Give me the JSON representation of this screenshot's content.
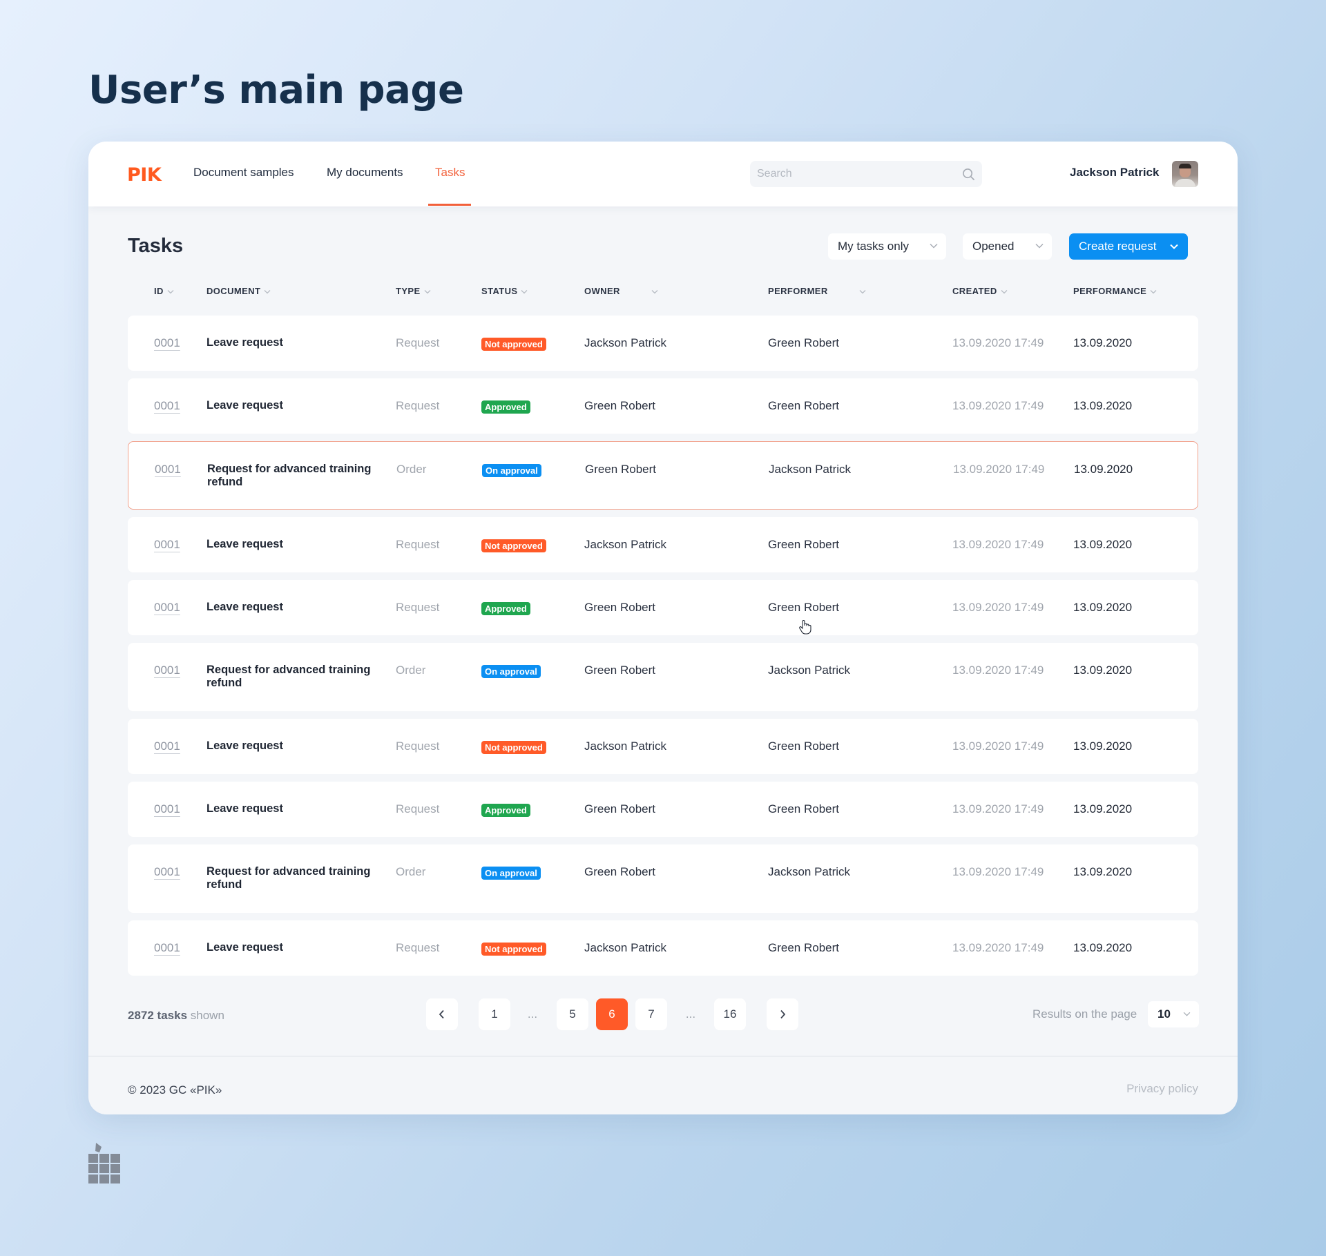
{
  "page": {
    "title": "User’s main page"
  },
  "header": {
    "logo": "PIK",
    "nav": [
      {
        "label": "Document samples",
        "active": false
      },
      {
        "label": "My documents",
        "active": false
      },
      {
        "label": "Tasks",
        "active": true
      }
    ],
    "search": {
      "placeholder": "Search",
      "value": ""
    },
    "user_name": "Jackson Patrick",
    "accent_color": "#f2603a"
  },
  "toolbar": {
    "title": "Tasks",
    "filter_scope": "My tasks only",
    "filter_state": "Opened",
    "create_label": "Create request",
    "create_color": "#0b8ff2"
  },
  "table": {
    "columns": [
      "ID",
      "DOCUMENT",
      "TYPE",
      "STATUS",
      "OWNER",
      "PERFORMER",
      "CREATED",
      "PERFORMANCE"
    ],
    "status_colors": {
      "Not approved": "#ff5a28",
      "Approved": "#1fa64f",
      "On approval": "#0b8ff2"
    },
    "rows": [
      {
        "id": "0001",
        "document": "Leave request",
        "type": "Request",
        "status": "Not approved",
        "owner": "Jackson Patrick",
        "performer": "Green Robert",
        "created": "13.09.2020 17:49",
        "performance": "13.09.2020"
      },
      {
        "id": "0001",
        "document": "Leave request",
        "type": "Request",
        "status": "Approved",
        "owner": "Green Robert",
        "performer": "Green Robert",
        "created": "13.09.2020 17:49",
        "performance": "13.09.2020"
      },
      {
        "id": "0001",
        "document": "Request for advanced training refund",
        "type": "Order",
        "status": "On approval",
        "owner": "Green Robert",
        "performer": "Jackson Patrick",
        "created": "13.09.2020 17:49",
        "performance": "13.09.2020",
        "hovered": true
      },
      {
        "id": "0001",
        "document": "Leave request",
        "type": "Request",
        "status": "Not approved",
        "owner": "Jackson Patrick",
        "performer": "Green Robert",
        "created": "13.09.2020 17:49",
        "performance": "13.09.2020"
      },
      {
        "id": "0001",
        "document": "Leave request",
        "type": "Request",
        "status": "Approved",
        "owner": "Green Robert",
        "performer": "Green Robert",
        "created": "13.09.2020 17:49",
        "performance": "13.09.2020"
      },
      {
        "id": "0001",
        "document": "Request for advanced training refund",
        "type": "Order",
        "status": "On approval",
        "owner": "Green Robert",
        "performer": "Jackson Patrick",
        "created": "13.09.2020 17:49",
        "performance": "13.09.2020"
      },
      {
        "id": "0001",
        "document": "Leave request",
        "type": "Request",
        "status": "Not approved",
        "owner": "Jackson Patrick",
        "performer": "Green Robert",
        "created": "13.09.2020 17:49",
        "performance": "13.09.2020"
      },
      {
        "id": "0001",
        "document": "Leave request",
        "type": "Request",
        "status": "Approved",
        "owner": "Green Robert",
        "performer": "Green Robert",
        "created": "13.09.2020 17:49",
        "performance": "13.09.2020"
      },
      {
        "id": "0001",
        "document": "Request for advanced training refund",
        "type": "Order",
        "status": "On approval",
        "owner": "Green Robert",
        "performer": "Jackson Patrick",
        "created": "13.09.2020 17:49",
        "performance": "13.09.2020"
      },
      {
        "id": "0001",
        "document": "Leave request",
        "type": "Request",
        "status": "Not approved",
        "owner": "Jackson Patrick",
        "performer": "Green Robert",
        "created": "13.09.2020 17:49",
        "performance": "13.09.2020"
      }
    ]
  },
  "pagination": {
    "count_number": "2872 tasks",
    "count_suffix": " shown",
    "pages": [
      "1",
      "...",
      "5",
      "6",
      "7",
      "...",
      "16"
    ],
    "current_page": "6",
    "results_label": "Results on the page",
    "results_value": "10"
  },
  "footer": {
    "copyright": "© 2023 GC «PIK»",
    "privacy": "Privacy policy"
  }
}
